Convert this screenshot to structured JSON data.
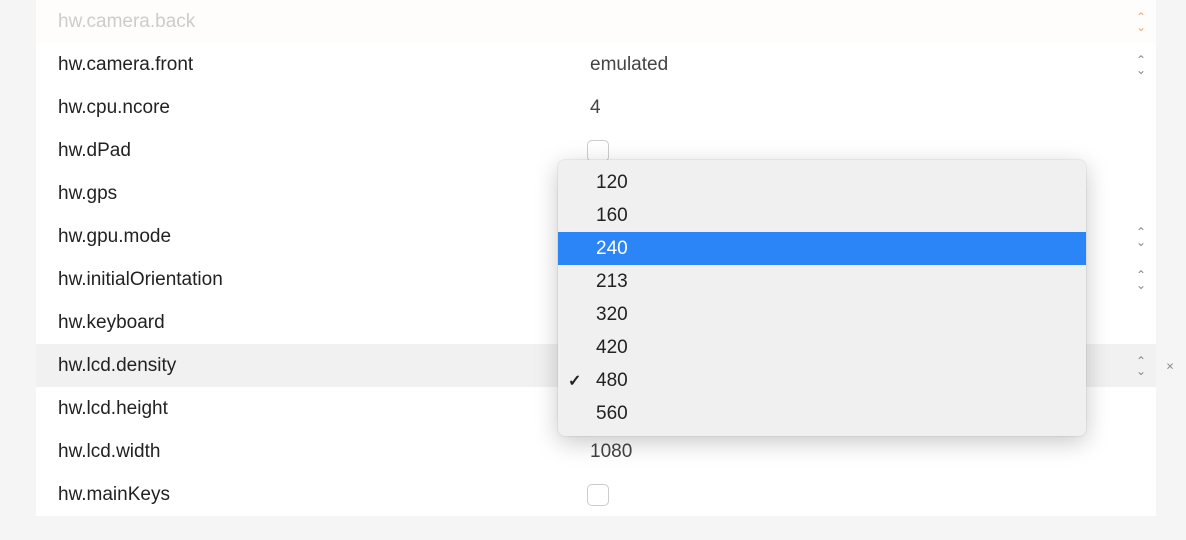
{
  "rows": [
    {
      "key": "camera_back",
      "label": "hw.camera.back",
      "value": "",
      "type": "select",
      "stepper": "orange",
      "disabled": true
    },
    {
      "key": "camera_front",
      "label": "hw.camera.front",
      "value": "emulated",
      "type": "select",
      "stepper": "gray"
    },
    {
      "key": "cpu_ncore",
      "label": "hw.cpu.ncore",
      "value": "4",
      "type": "text"
    },
    {
      "key": "dpad",
      "label": "hw.dPad",
      "value": "",
      "type": "checkbox"
    },
    {
      "key": "gps",
      "label": "hw.gps",
      "value": "",
      "type": "text"
    },
    {
      "key": "gpu_mode",
      "label": "hw.gpu.mode",
      "value": "",
      "type": "select",
      "stepper": "gray"
    },
    {
      "key": "initial_orient",
      "label": "hw.initialOrientation",
      "value": "",
      "type": "select",
      "stepper": "gray"
    },
    {
      "key": "keyboard",
      "label": "hw.keyboard",
      "value": "",
      "type": "text"
    },
    {
      "key": "lcd_density",
      "label": "hw.lcd.density",
      "value": "",
      "type": "select",
      "stepper": "gray",
      "selected": true
    },
    {
      "key": "lcd_height",
      "label": "hw.lcd.height",
      "value": "",
      "type": "text"
    },
    {
      "key": "lcd_width",
      "label": "hw.lcd.width",
      "value": "1080",
      "type": "text"
    },
    {
      "key": "main_keys",
      "label": "hw.mainKeys",
      "value": "",
      "type": "checkbox"
    }
  ],
  "dropdown": {
    "options": [
      "120",
      "160",
      "240",
      "213",
      "320",
      "420",
      "480",
      "560"
    ],
    "highlighted": "240",
    "checked": "480"
  }
}
